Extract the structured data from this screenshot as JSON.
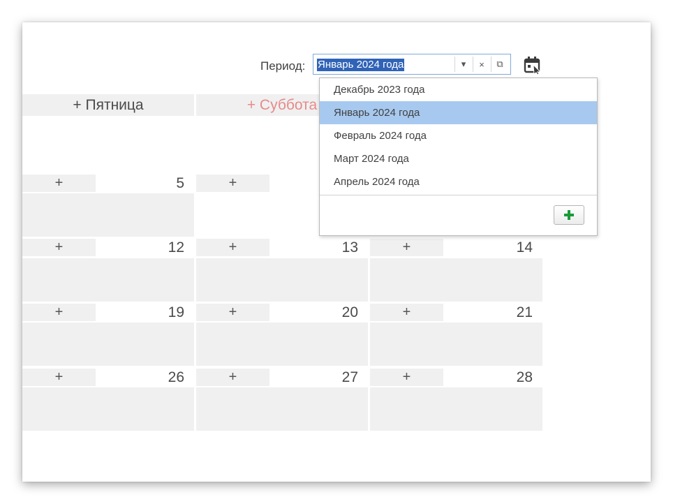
{
  "period": {
    "label": "Период:",
    "value": "Январь 2024 года",
    "dropdown_glyph": "▾",
    "clear_glyph": "×",
    "open_glyph": "⧉"
  },
  "days": {
    "friday": "+ Пятница",
    "saturday": "+ Суббота"
  },
  "grid": {
    "plus": "+",
    "rows": [
      {
        "fri": "5",
        "sat": "",
        "sun": ""
      },
      {
        "fri": "12",
        "sat": "13",
        "sun": "14"
      },
      {
        "fri": "19",
        "sat": "20",
        "sun": "21"
      },
      {
        "fri": "26",
        "sat": "27",
        "sun": "28"
      }
    ]
  },
  "dropdown": {
    "items": [
      {
        "label": "Декабрь 2023 года",
        "selected": false
      },
      {
        "label": "Январь 2024 года",
        "selected": true
      },
      {
        "label": "Февраль 2024 года",
        "selected": false
      },
      {
        "label": "Март 2024 года",
        "selected": false
      },
      {
        "label": "Апрель 2024 года",
        "selected": false
      }
    ],
    "add_icon": "plus-icon"
  },
  "colors": {
    "selection": "#2f63b8",
    "dropdown_highlight": "#a7c9ef",
    "weekend_text": "#e78a8a",
    "add_green": "#1a9a3c"
  }
}
